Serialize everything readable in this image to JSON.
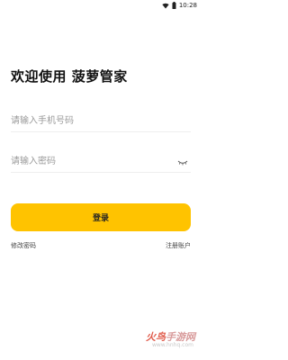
{
  "status_bar": {
    "time": "10:28",
    "wifi_icon": "wifi-icon",
    "battery_icon": "battery-icon"
  },
  "title": "欢迎使用 菠萝管家",
  "phone_field": {
    "placeholder": "请输入手机号码",
    "value": ""
  },
  "password_field": {
    "placeholder": "请输入密码",
    "value": "",
    "toggle_icon": "eye-closed-icon"
  },
  "login_button": {
    "label": "登录",
    "color": "#ffc300"
  },
  "links": {
    "change_password": "修改密码",
    "register": "注册账户"
  },
  "watermark": {
    "main_a": "火鸟",
    "main_b": "手游网",
    "sub": "www.hnhq.com"
  }
}
